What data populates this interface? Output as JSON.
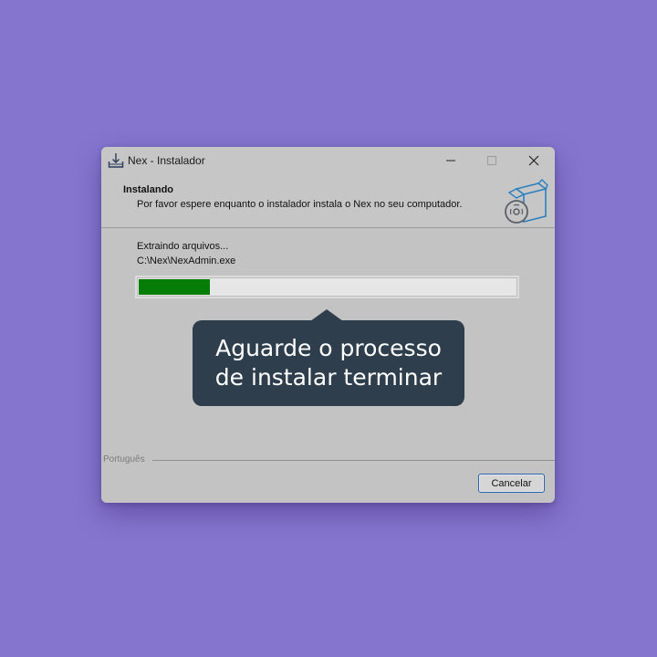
{
  "window": {
    "title": "Nex - Instalador",
    "app_icon": "download-tray-icon"
  },
  "header": {
    "title": "Instalando",
    "subtitle": "Por favor espere enquanto o instalador instala o Nex no seu computador.",
    "image_icon": "software-box-disc-icon"
  },
  "body": {
    "status": "Extraindo arquivos...",
    "file_path": "C:\\Nex\\NexAdmin.exe",
    "progress": 0.19
  },
  "tooltip": {
    "line1": "Aguarde o processo",
    "line2": "de instalar terminar"
  },
  "footer": {
    "language": "Português",
    "cancel_label": "Cancelar"
  },
  "colors": {
    "background": "#8675cf",
    "progress": "#067d06",
    "tooltip": "#2e3e4c",
    "button_border": "#2a64b0"
  }
}
